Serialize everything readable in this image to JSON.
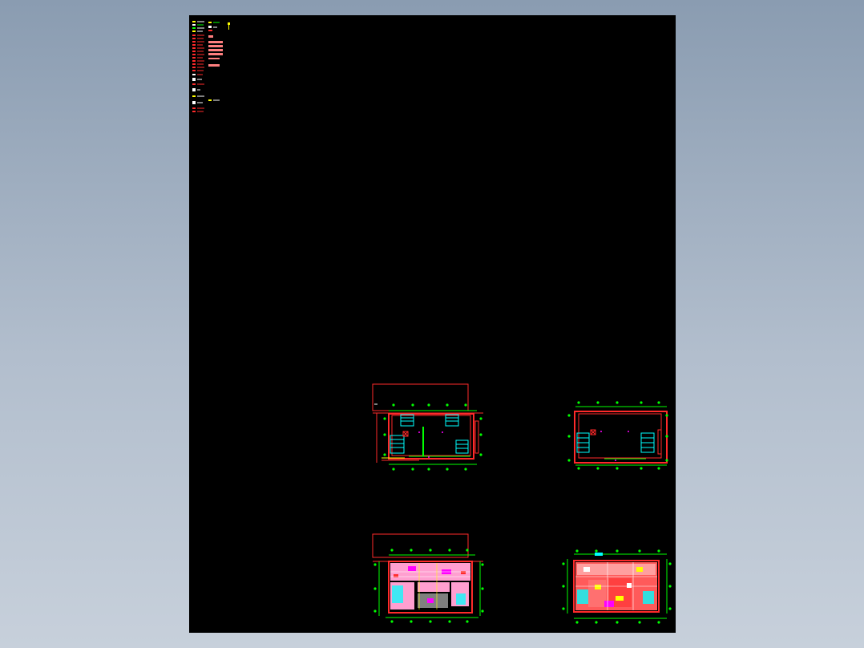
{
  "window": {
    "canvas_label": ""
  },
  "colors": {
    "background_top": "#8a9cb1",
    "background_bottom": "#c7d0db",
    "paper": "#000000",
    "red": "#ff2a2a",
    "green": "#00ff00",
    "cyan": "#00ffff",
    "yellow": "#ffff00",
    "magenta": "#ff00ff",
    "white": "#ffffff",
    "pink": "#ff9fd0"
  },
  "drawings": {
    "legend": {
      "icon": "legend-table-icon"
    },
    "plans": [
      {
        "id": "plan-top-left",
        "icon": "floor-plan-icon"
      },
      {
        "id": "plan-top-right",
        "icon": "floor-plan-icon"
      },
      {
        "id": "plan-bottom-left",
        "icon": "dense-floor-plan-icon"
      },
      {
        "id": "plan-bottom-right",
        "icon": "dense-floor-plan-icon"
      }
    ]
  }
}
